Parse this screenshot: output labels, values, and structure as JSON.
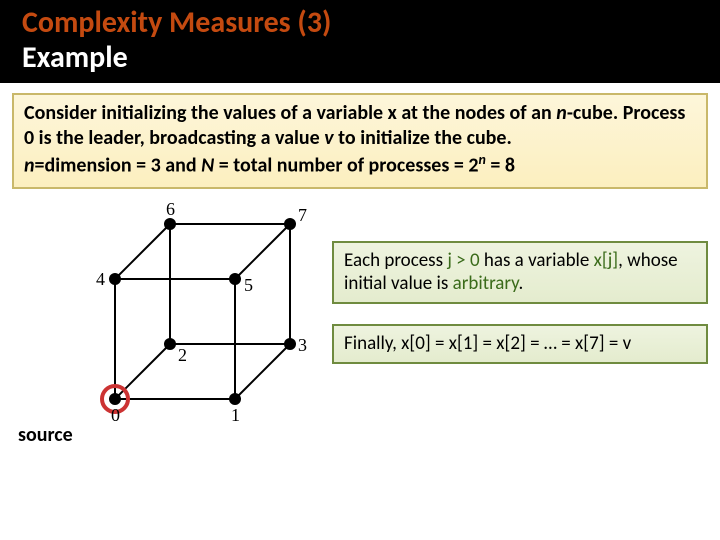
{
  "header": {
    "title_accent": "Complexity Measures (3)",
    "title_main": "Example"
  },
  "description": {
    "line1a": "Consider initializing the values of a variable x at the nodes of an ",
    "line1b_italic": "n",
    "line1c": "-cube. Process 0 is the leader, broadcasting a value ",
    "line1d_italic": "v",
    "line1e": " to initialize the cube.",
    "line2a_italic": "n",
    "line2b": "=dimension = 3 and ",
    "line2c_italic": "N",
    "line2d": " = total number of processes = 2",
    "line2e_sup_italic": "n",
    "line2f": " = 8"
  },
  "cube": {
    "labels": {
      "v0": "0",
      "v1": "1",
      "v2": "2",
      "v3": "3",
      "v4": "4",
      "v5": "5",
      "v6": "6",
      "v7": "7"
    },
    "source_label": "source"
  },
  "box_process": {
    "a": "Each process ",
    "b_hl": "j > 0",
    "c": " has a variable ",
    "d_hl": "x[j]",
    "e": ", whose initial value is ",
    "f_hl": "arbitrary",
    "g": "."
  },
  "box_finally": {
    "text": "Finally, x[0] = x[1] = x[2] = … = x[7] = v"
  }
}
